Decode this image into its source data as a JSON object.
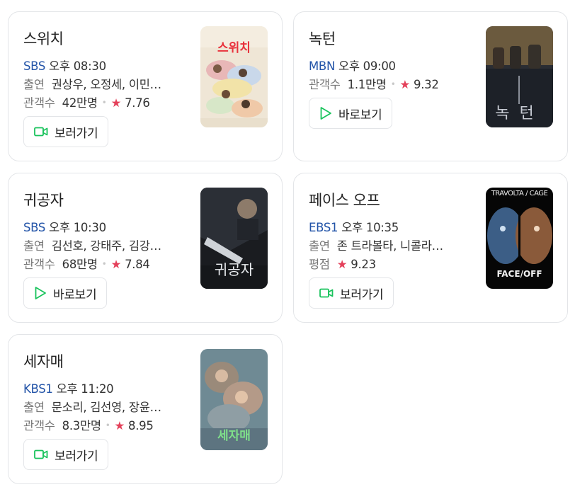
{
  "cards": [
    {
      "title": "스위치",
      "channel": "SBS",
      "time": "오후 08:30",
      "cast_label": "출연",
      "cast": "권상우, 오정세, 이민…",
      "stat_label": "관객수",
      "stat_value": "42만명",
      "rating": "7.76",
      "button_label": "보러가기",
      "button_icon": "video-camera-icon",
      "poster_title": "스위치"
    },
    {
      "title": "녹턴",
      "channel": "MBN",
      "time": "오후 09:00",
      "stat_label": "관객수",
      "stat_value": "1.1만명",
      "rating": "9.32",
      "button_label": "바로보기",
      "button_icon": "play-icon",
      "poster_title": "녹턴"
    },
    {
      "title": "귀공자",
      "channel": "SBS",
      "time": "오후 10:30",
      "cast_label": "출연",
      "cast": "김선호, 강태주, 김강…",
      "stat_label": "관객수",
      "stat_value": "68만명",
      "rating": "7.84",
      "button_label": "바로보기",
      "button_icon": "play-icon",
      "poster_title": "귀공자"
    },
    {
      "title": "페이스 오프",
      "channel": "EBS1",
      "time": "오후 10:35",
      "cast_label": "출연",
      "cast": "존 트라볼타, 니콜라…",
      "stat_label": "평점",
      "rating": "9.23",
      "button_label": "보러가기",
      "button_icon": "video-camera-icon",
      "poster_title": "FACE/OFF",
      "poster_top_text": "TRAVOLTA / CAGE"
    },
    {
      "title": "세자매",
      "channel": "KBS1",
      "time": "오후 11:20",
      "cast_label": "출연",
      "cast": "문소리, 김선영, 장윤…",
      "stat_label": "관객수",
      "stat_value": "8.3만명",
      "rating": "8.95",
      "button_label": "보러가기",
      "button_icon": "video-camera-icon",
      "poster_title": "세자매"
    }
  ],
  "colors": {
    "channel": "#2354a8",
    "star": "#e4405a",
    "icon_green": "#19c35c",
    "border": "#e3e5e8"
  }
}
